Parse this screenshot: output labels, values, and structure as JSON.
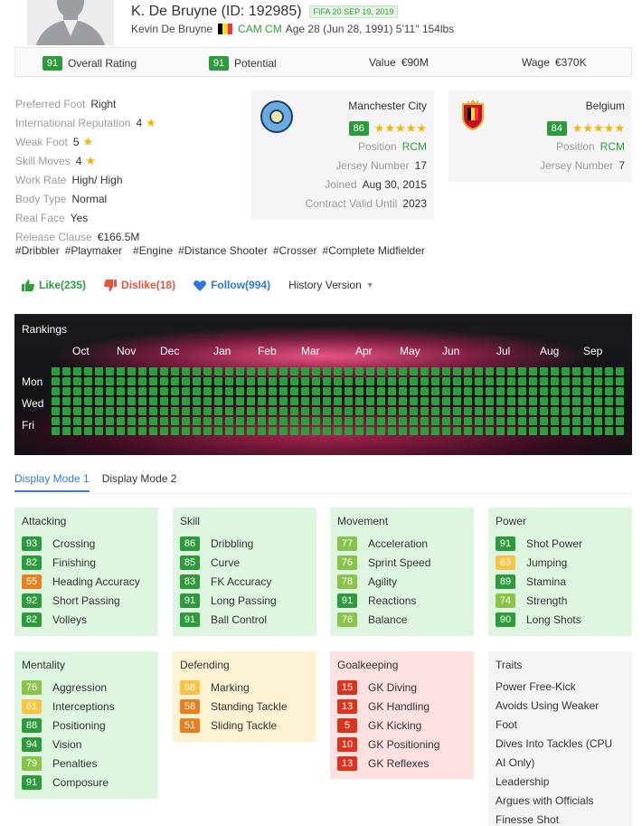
{
  "player": {
    "title": "K. De Bruyne (ID: 192985)",
    "fifa_badge": "FIFA 20 SEP 19, 2019",
    "full_name": "Kevin De Bruyne",
    "positions": "CAM CM",
    "details": "Age 28 (Jun 28, 1991) 5'11\" 154lbs"
  },
  "stats_bar": {
    "overall_value": "91",
    "overall_label": "Overall Rating",
    "potential_value": "91",
    "potential_label": "Potential",
    "value_label": "Value",
    "value_amount": "€90M",
    "wage_label": "Wage",
    "wage_amount": "€370K"
  },
  "info": [
    {
      "label": "Preferred Foot",
      "value": "Right",
      "star": false
    },
    {
      "label": "International Reputation",
      "value": "4",
      "star": true
    },
    {
      "label": "Weak Foot",
      "value": "5",
      "star": true
    },
    {
      "label": "Skill Moves",
      "value": "4",
      "star": true
    },
    {
      "label": "Work Rate",
      "value": "High/ High",
      "star": false
    },
    {
      "label": "Body Type",
      "value": "Normal",
      "star": false
    },
    {
      "label": "Real Face",
      "value": "Yes",
      "star": false
    },
    {
      "label": "Release Clause",
      "value": "€166.5M",
      "star": false
    }
  ],
  "tags": [
    "#Dribbler",
    "#Playmaker",
    "#Engine",
    "#Distance Shooter",
    "#Crosser",
    "#Complete Midfielder"
  ],
  "club": {
    "name": "Manchester City",
    "rating": "86",
    "stars": "★★★★★",
    "position_label": "Position",
    "position": "RCM",
    "jersey_label": "Jersey Number",
    "jersey": "17",
    "joined_label": "Joined",
    "joined": "Aug 30, 2015",
    "contract_label": "Contract Valid Until",
    "contract": "2023"
  },
  "nation": {
    "name": "Belgium",
    "rating": "84",
    "stars": "★★★★★",
    "position_label": "Position",
    "position": "RCM",
    "jersey_label": "Jersey Number",
    "jersey": "7"
  },
  "actions": {
    "like": "Like(235)",
    "dislike": "Dislike(18)",
    "follow": "Follow(994)",
    "history": "History Version"
  },
  "rankings": {
    "title": "Rankings",
    "months": [
      "Oct",
      "Nov",
      "Dec",
      "Jan",
      "Feb",
      "Mar",
      "Apr",
      "May",
      "Jun",
      "Jul",
      "Aug",
      "Sep"
    ],
    "days": [
      "Mon",
      "Wed",
      "Fri"
    ]
  },
  "tabs": [
    "Display Mode 1",
    "Display Mode 2"
  ],
  "attributes": {
    "attacking": {
      "title": "Attacking",
      "items": [
        {
          "v": "93",
          "l": "Crossing",
          "c": "dg"
        },
        {
          "v": "82",
          "l": "Finishing",
          "c": "dg"
        },
        {
          "v": "55",
          "l": "Heading Accuracy",
          "c": "o"
        },
        {
          "v": "92",
          "l": "Short Passing",
          "c": "dg"
        },
        {
          "v": "82",
          "l": "Volleys",
          "c": "dg"
        }
      ]
    },
    "skill": {
      "title": "Skill",
      "items": [
        {
          "v": "86",
          "l": "Dribbling",
          "c": "dg"
        },
        {
          "v": "85",
          "l": "Curve",
          "c": "dg"
        },
        {
          "v": "83",
          "l": "FK Accuracy",
          "c": "dg"
        },
        {
          "v": "91",
          "l": "Long Passing",
          "c": "dg"
        },
        {
          "v": "91",
          "l": "Ball Control",
          "c": "dg"
        }
      ]
    },
    "movement": {
      "title": "Movement",
      "items": [
        {
          "v": "77",
          "l": "Acceleration",
          "c": "lg"
        },
        {
          "v": "76",
          "l": "Sprint Speed",
          "c": "lg"
        },
        {
          "v": "78",
          "l": "Agility",
          "c": "lg"
        },
        {
          "v": "91",
          "l": "Reactions",
          "c": "dg"
        },
        {
          "v": "76",
          "l": "Balance",
          "c": "lg"
        }
      ]
    },
    "power": {
      "title": "Power",
      "items": [
        {
          "v": "91",
          "l": "Shot Power",
          "c": "dg"
        },
        {
          "v": "63",
          "l": "Jumping",
          "c": "y"
        },
        {
          "v": "89",
          "l": "Stamina",
          "c": "dg"
        },
        {
          "v": "74",
          "l": "Strength",
          "c": "lg"
        },
        {
          "v": "90",
          "l": "Long Shots",
          "c": "dg"
        }
      ]
    },
    "mentality": {
      "title": "Mentality",
      "items": [
        {
          "v": "76",
          "l": "Aggression",
          "c": "lg"
        },
        {
          "v": "61",
          "l": "Interceptions",
          "c": "y"
        },
        {
          "v": "88",
          "l": "Positioning",
          "c": "dg"
        },
        {
          "v": "94",
          "l": "Vision",
          "c": "dg"
        },
        {
          "v": "79",
          "l": "Penalties",
          "c": "lg"
        },
        {
          "v": "91",
          "l": "Composure",
          "c": "dg"
        }
      ]
    },
    "defending": {
      "title": "Defending",
      "items": [
        {
          "v": "68",
          "l": "Marking",
          "c": "y"
        },
        {
          "v": "58",
          "l": "Standing Tackle",
          "c": "o"
        },
        {
          "v": "51",
          "l": "Sliding Tackle",
          "c": "o"
        }
      ]
    },
    "goalkeeping": {
      "title": "Goalkeeping",
      "items": [
        {
          "v": "15",
          "l": "GK Diving",
          "c": "r"
        },
        {
          "v": "13",
          "l": "GK Handling",
          "c": "r"
        },
        {
          "v": "5",
          "l": "GK Kicking",
          "c": "r"
        },
        {
          "v": "10",
          "l": "GK Positioning",
          "c": "r"
        },
        {
          "v": "13",
          "l": "GK Reflexes",
          "c": "r"
        }
      ]
    }
  },
  "traits": {
    "title": "Traits",
    "lines": [
      "Power Free-Kick",
      "Avoids Using Weaker",
      "Foot",
      "Dives Into Tackles (CPU",
      "AI Only)",
      "Leadership",
      "Argues with Officials",
      "Finesse Shot"
    ]
  },
  "colors": {
    "dark_green": "#2d9b3c",
    "light_green": "#8bc34a",
    "yellow": "#f6c343",
    "orange": "#e67e22",
    "red": "#d9341f",
    "link_blue": "#2f7ad8"
  }
}
